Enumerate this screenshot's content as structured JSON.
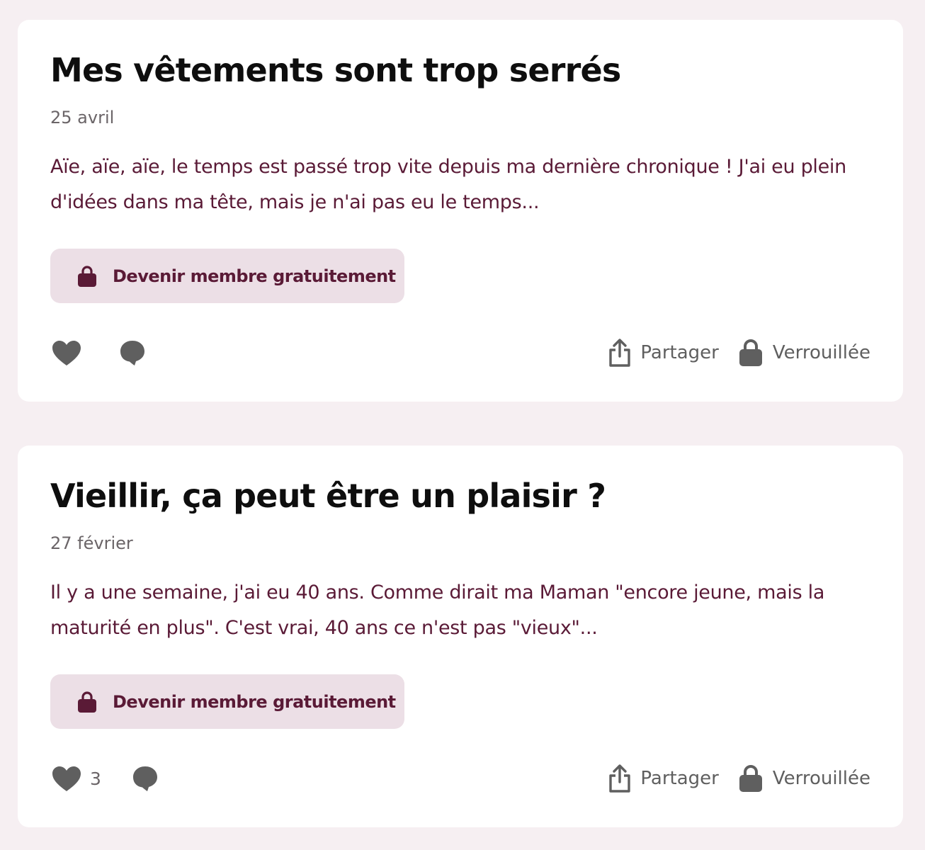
{
  "colors": {
    "page_background": "#f6eff2",
    "card_background": "#ffffff",
    "accent": "#5a1a36",
    "button_background": "#ecdfe6",
    "icon_gray": "#5f5f5f"
  },
  "posts": [
    {
      "title": "Mes vêtements sont trop serrés",
      "date": "25 avril",
      "excerpt": "Aïe, aïe, aïe, le temps est passé trop vite depuis ma dernière chronique ! J'ai eu plein d'idées dans ma tête, mais je n'ai pas eu le temps...",
      "join_label": "Devenir membre gratuitement",
      "like_count": "",
      "share_label": "Partager",
      "locked_label": "Verrouillée",
      "icons": [
        "lock-icon",
        "heart-icon",
        "comment-icon",
        "share-icon",
        "lock-icon"
      ]
    },
    {
      "title": "Vieillir, ça peut être un plaisir ?",
      "date": "27 février",
      "excerpt": "Il y a une semaine, j'ai eu 40 ans. Comme dirait ma Maman \"encore jeune, mais la maturité en plus\". C'est vrai, 40 ans ce n'est pas \"vieux\"...",
      "join_label": "Devenir membre gratuitement",
      "like_count": "3",
      "share_label": "Partager",
      "locked_label": "Verrouillée",
      "icons": [
        "lock-icon",
        "heart-icon",
        "comment-icon",
        "share-icon",
        "lock-icon"
      ]
    }
  ]
}
